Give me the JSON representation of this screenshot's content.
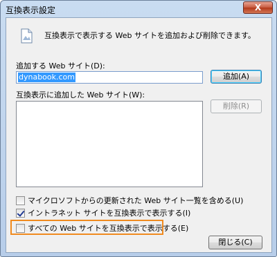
{
  "window": {
    "title": "互換表示設定",
    "close_label": "X"
  },
  "description": "互換表示で表示する Web サイトを追加および削除できます。",
  "add_site": {
    "label": "追加する Web サイト(D):",
    "value": "dynabook.com",
    "add_button": "追加(A)"
  },
  "site_list": {
    "label": "互換表示に追加した Web サイト(W):",
    "items": [],
    "remove_button": "削除(R)"
  },
  "options": [
    {
      "label": "マイクロソフトからの更新された Web サイト一覧を含める(U)",
      "checked": false
    },
    {
      "label": "イントラネット サイトを互換表示で表示する(I)",
      "checked": true
    },
    {
      "label": "すべての Web サイトを互換表示で表示する(E)",
      "checked": false
    }
  ],
  "close_button": "閉じる(C)",
  "colors": {
    "highlight": "#f08a1e",
    "selection": "#3399ff"
  }
}
